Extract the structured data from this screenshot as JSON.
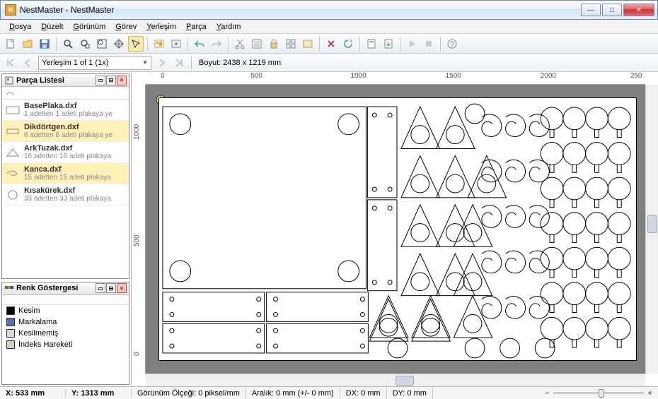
{
  "window": {
    "title": "NestMaster - NestMaster",
    "icon_letter": "N"
  },
  "menu": [
    "Dosya",
    "Düzelt",
    "Görünüm",
    "Görev",
    "Yerleşim",
    "Parça",
    "Yardım"
  ],
  "toolbar2": {
    "combo_value": "Yerleşim 1 of 1 (1x)",
    "size_label": "Boyut:",
    "size_value": "2438 x 1219 mm"
  },
  "panels": {
    "parts": {
      "title": "Parça Listesi"
    },
    "legend": {
      "title": "Renk Göstergesi"
    }
  },
  "parts": [
    {
      "name": "BasePlaka.dxf",
      "desc": "1 adetten 1 adeti plakaya ye",
      "hl": false,
      "shape": "rect"
    },
    {
      "name": "Dikdörtgen.dxf",
      "desc": "6 adetten 6 adeti plakaya ye",
      "hl": true,
      "shape": "smallrect"
    },
    {
      "name": "ArkTuzak.dxf",
      "desc": "16 adetten 16 adeti plakaya",
      "hl": false,
      "shape": "triangle"
    },
    {
      "name": "Kanca.dxf",
      "desc": "15 adetten 15 adeti plakaya",
      "hl": true,
      "shape": "hook"
    },
    {
      "name": "Kısakürek.dxf",
      "desc": "33 adetten 33 adeti plakaya",
      "hl": false,
      "shape": "circle"
    }
  ],
  "legend": [
    {
      "label": "Kesim",
      "color": "#000000"
    },
    {
      "label": "Markalama",
      "color": "#5b6fb0"
    },
    {
      "label": "Kesilmemiş",
      "color": "#d8d8d8"
    },
    {
      "label": "İndeks Hareketi",
      "color": "#d0ccc0"
    }
  ],
  "ruler_h": [
    {
      "v": "0",
      "p": 3
    },
    {
      "v": "500",
      "p": 21
    },
    {
      "v": "1000",
      "p": 41
    },
    {
      "v": "1500",
      "p": 60
    },
    {
      "v": "2000",
      "p": 79
    },
    {
      "v": "250",
      "p": 97
    }
  ],
  "ruler_v": [
    {
      "v": "0",
      "p": 94
    },
    {
      "v": "500",
      "p": 56
    },
    {
      "v": "1000",
      "p": 19
    }
  ],
  "status": {
    "x": "X: 533 mm",
    "y": "Y: 1313 mm",
    "scale": "Görünüm Ölçeği: 0 piksel/mm",
    "aralik": "Aralık: 0 mm (+/- 0 mm)",
    "dx": "DX: 0 mm",
    "dy": "DY: 0 mm"
  }
}
